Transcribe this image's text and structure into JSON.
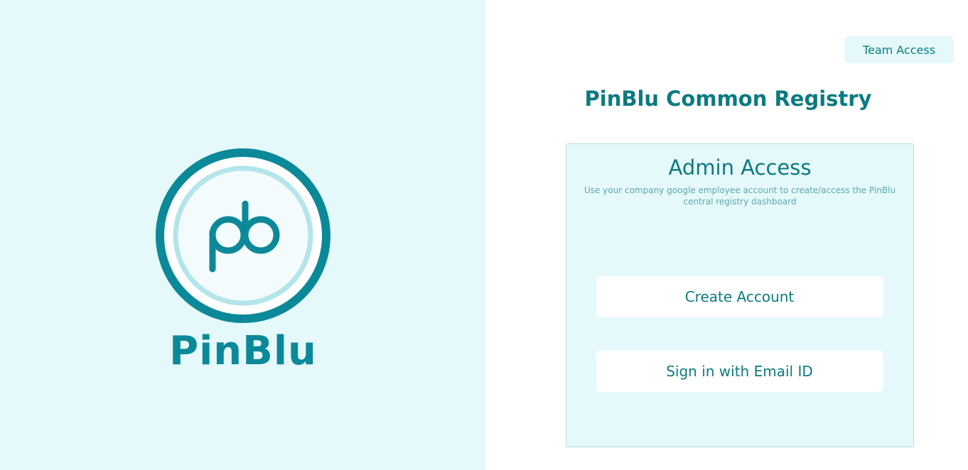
{
  "brand": {
    "logo_monogram": "pb",
    "name": "PinBlu"
  },
  "header": {
    "team_access_label": "Team Access"
  },
  "main": {
    "title": "PinBlu Common Registry"
  },
  "card": {
    "title": "Admin Access",
    "subtitle": "Use your company google employee account to create/access the PinBlu central registry dashboard",
    "create_account_label": "Create Account",
    "sign_in_label": "Sign in with Email ID"
  },
  "colors": {
    "panel_bg": "#e5f9fb",
    "accent_teal": "#0b7b80",
    "logo_teal": "#0c8999",
    "logo_light_ring": "#b3e5ea"
  }
}
